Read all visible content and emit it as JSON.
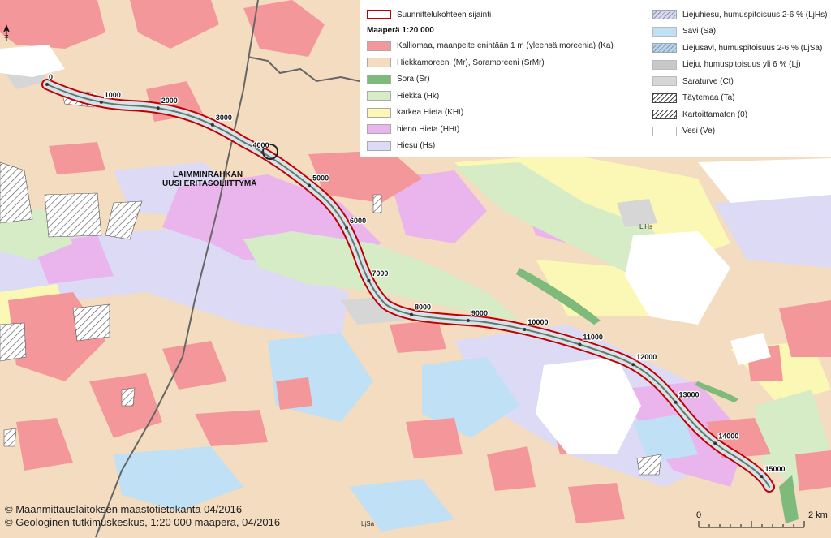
{
  "legend": {
    "route_label": "Suunnittelukohteen sijainti",
    "section_title": "Maaperä 1:20 000",
    "left_items": [
      {
        "label": "Kalliomaa, maanpeite enintään 1 m (yleensä moreenia) (Ka)",
        "color": "#f4979a"
      },
      {
        "label": "Hiekkamoreeni (Mr), Soramoreeni (SrMr)",
        "color": "#f3dcc0"
      },
      {
        "label": "Sora (Sr)",
        "color": "#7dba7c"
      },
      {
        "label": "Hiekka (Hk)",
        "color": "#d5ecc6"
      },
      {
        "label": "karkea Hieta (KHt)",
        "color": "#fbf7b5"
      },
      {
        "label": "hieno Hieta (HHt)",
        "color": "#e9b5ec"
      },
      {
        "label": "Hiesu (Hs)",
        "color": "#dcdaf5"
      }
    ],
    "right_items": [
      {
        "label": "Liejuhiesu, humuspitoisuus 2-6 % (LjHs)",
        "color": "#d9d6ef",
        "pattern": "hatch-soft"
      },
      {
        "label": "Savi (Sa)",
        "color": "#bfe0f5",
        "pattern": "plain"
      },
      {
        "label": "Liejusavi, humuspitoisuus 2-6 % (LjSa)",
        "color": "#b8d4ea",
        "pattern": "hatch-soft"
      },
      {
        "label": "Lieju, humuspitoisuus yli 6 % (Lj)",
        "color": "#c8c8c8",
        "pattern": "plain"
      },
      {
        "label": "Saraturve (Ct)",
        "color": "#d6d6d6",
        "pattern": "plain"
      },
      {
        "label": "Täytemaa (Ta)",
        "color": "#ffffff",
        "pattern": "hatch"
      },
      {
        "label": "Kartoittamaton (0)",
        "color": "#ffffff",
        "pattern": "hatch"
      },
      {
        "label": "Vesi (Ve)",
        "color": "#ffffff",
        "pattern": "plain"
      }
    ]
  },
  "route": {
    "color": "#c00000",
    "chainage_labels": [
      "0",
      "1000",
      "2000",
      "3000",
      "4000",
      "5000",
      "6000",
      "7000",
      "8000",
      "9000",
      "10000",
      "11000",
      "12000",
      "13000",
      "14000",
      "15000"
    ]
  },
  "map_labels": {
    "interchange_line1": "LAIMMINRAHKAN",
    "interchange_line2": "UUSI ERITASOLIITTYMÄ",
    "ljhs": "LjHs",
    "ljsa": "LjSa",
    "north": "N"
  },
  "scale": {
    "start": "0",
    "end": "2 km"
  },
  "credits": {
    "line1": "© Maanmittauslaitoksen maastotietokanta 04/2016",
    "line2": "© Geologinen tutkimuskeskus, 1:20 000 maaperä, 04/2016"
  }
}
